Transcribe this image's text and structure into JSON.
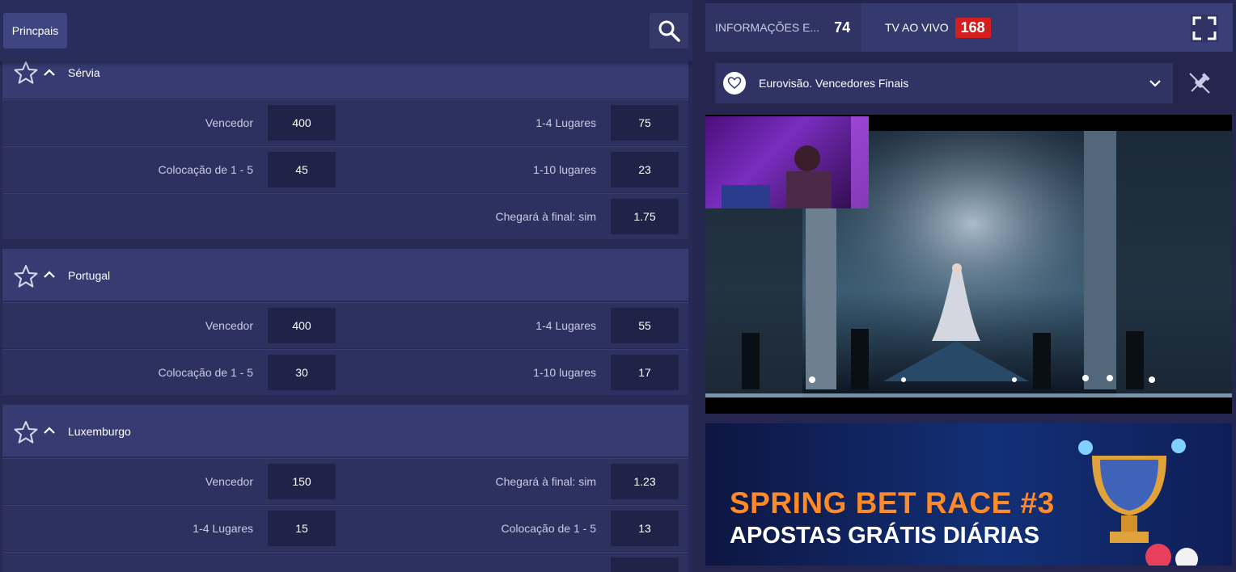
{
  "top_bar": {
    "tab_label": "Princpais"
  },
  "sections": [
    {
      "title": "Sérvia",
      "rows": [
        {
          "left_label": "Vencedor",
          "left_odd": "400",
          "right_label": "1-4 Lugares",
          "right_odd": "75"
        },
        {
          "left_label": "Colocação de 1 - 5",
          "left_odd": "45",
          "right_label": "1-10 lugares",
          "right_odd": "23"
        },
        {
          "left_label": "",
          "left_odd": "",
          "right_label": "Chegará à final: sim",
          "right_odd": "1.75"
        }
      ]
    },
    {
      "title": "Portugal",
      "rows": [
        {
          "left_label": "Vencedor",
          "left_odd": "400",
          "right_label": "1-4 Lugares",
          "right_odd": "55"
        },
        {
          "left_label": "Colocação de 1 - 5",
          "left_odd": "30",
          "right_label": "1-10 lugares",
          "right_odd": "17"
        }
      ]
    },
    {
      "title": "Luxemburgo",
      "rows": [
        {
          "left_label": "Vencedor",
          "left_odd": "150",
          "right_label": "Chegará à final: sim",
          "right_odd": "1.23"
        },
        {
          "left_label": "1-4 Lugares",
          "left_odd": "15",
          "right_label": "Colocação de 1 - 5",
          "right_odd": "13"
        }
      ]
    }
  ],
  "right_panel": {
    "tabs": [
      {
        "label": "INFORMAÇÕES E...",
        "count": "74"
      },
      {
        "label": "TV AO VIVO",
        "count": "168"
      }
    ],
    "event_name": "Eurovisão. Vencedores Finais",
    "promo": {
      "title": "SPRING BET RACE #3",
      "subtitle": "APOSTAS GRÁTIS DIÁRIAS"
    }
  },
  "colors": {
    "accent_red": "#d51f1f",
    "promo_orange": "#ff8a2a",
    "panel_bg": "#262a55"
  },
  "icons": [
    "search-icon",
    "star-icon",
    "chevron-up-icon",
    "fullscreen-icon",
    "heart-icon",
    "chevron-down-icon",
    "pin-icon"
  ]
}
